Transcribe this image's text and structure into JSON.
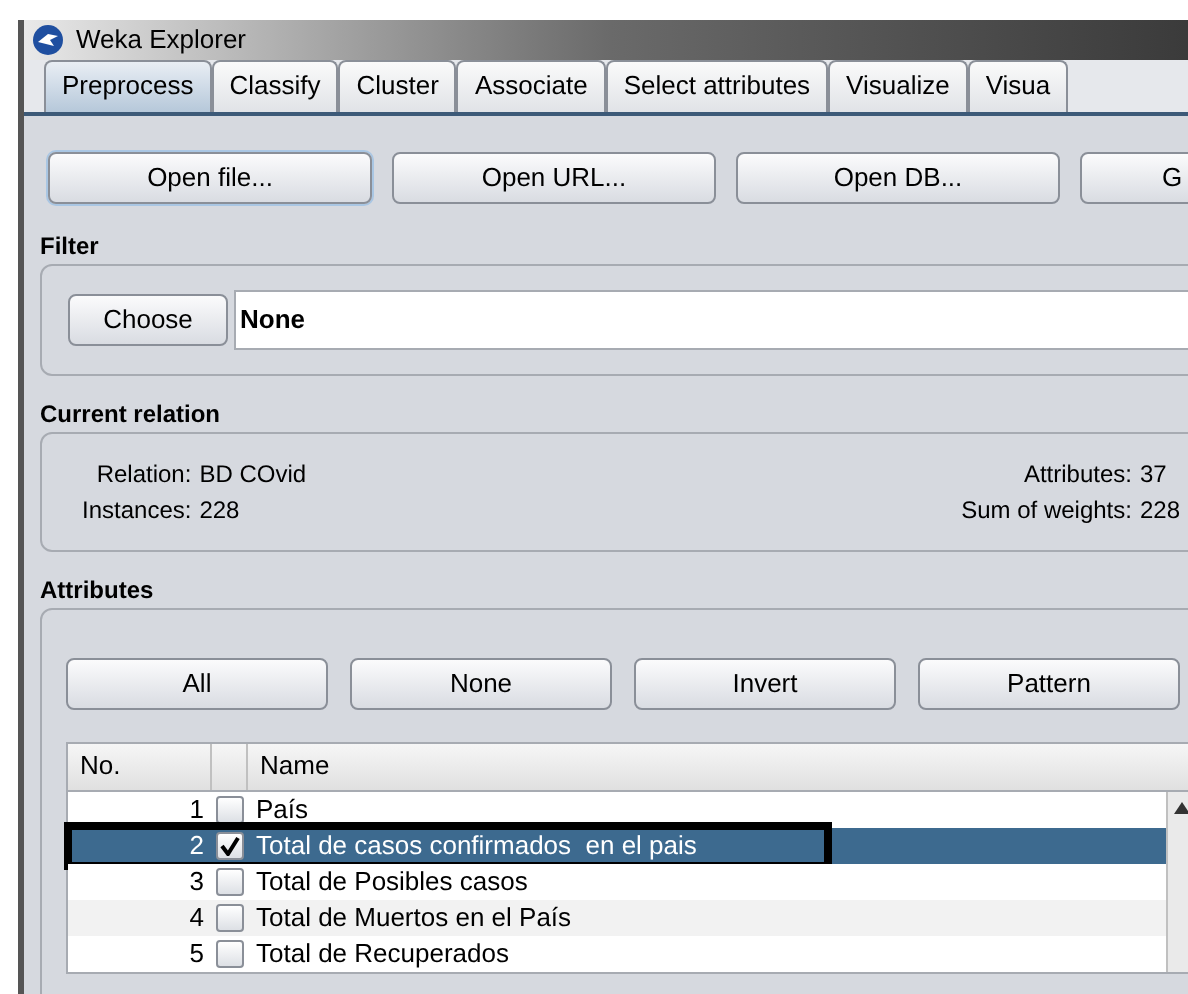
{
  "window": {
    "title": "Weka Explorer"
  },
  "tabs": [
    {
      "label": "Preprocess",
      "selected": true
    },
    {
      "label": "Classify",
      "selected": false
    },
    {
      "label": "Cluster",
      "selected": false
    },
    {
      "label": "Associate",
      "selected": false
    },
    {
      "label": "Select attributes",
      "selected": false
    },
    {
      "label": "Visualize",
      "selected": false
    },
    {
      "label": "Visua",
      "selected": false
    }
  ],
  "open_buttons": [
    {
      "label": "Open file...",
      "focused": true
    },
    {
      "label": "Open URL...",
      "focused": false
    },
    {
      "label": "Open DB...",
      "focused": false
    },
    {
      "label": "G",
      "focused": false
    }
  ],
  "filter": {
    "heading": "Filter",
    "button": "Choose",
    "value": "None"
  },
  "current_relation": {
    "heading": "Current relation",
    "relation_label": "Relation:",
    "relation": "BD COvid",
    "instances_label": "Instances:",
    "instances": "228",
    "attributes_label": "Attributes:",
    "attributes": "37",
    "weights_label": "Sum of weights:",
    "weights": "228"
  },
  "attributes": {
    "heading": "Attributes",
    "buttons": [
      "All",
      "None",
      "Invert",
      "Pattern"
    ],
    "columns": [
      "No.",
      "Name"
    ],
    "rows": [
      {
        "no": "1",
        "name": "País",
        "checked": false,
        "selected": false,
        "highlighted": false
      },
      {
        "no": "2",
        "name": "Total de casos confirmados  en el pais",
        "checked": true,
        "selected": true,
        "highlighted": true
      },
      {
        "no": "3",
        "name": "Total de Posibles casos",
        "checked": false,
        "selected": false,
        "highlighted": false
      },
      {
        "no": "4",
        "name": "Total de Muertos en el País",
        "checked": false,
        "selected": false,
        "highlighted": false
      },
      {
        "no": "5",
        "name": "Total de Recuperados",
        "checked": false,
        "selected": false,
        "highlighted": false
      }
    ]
  }
}
